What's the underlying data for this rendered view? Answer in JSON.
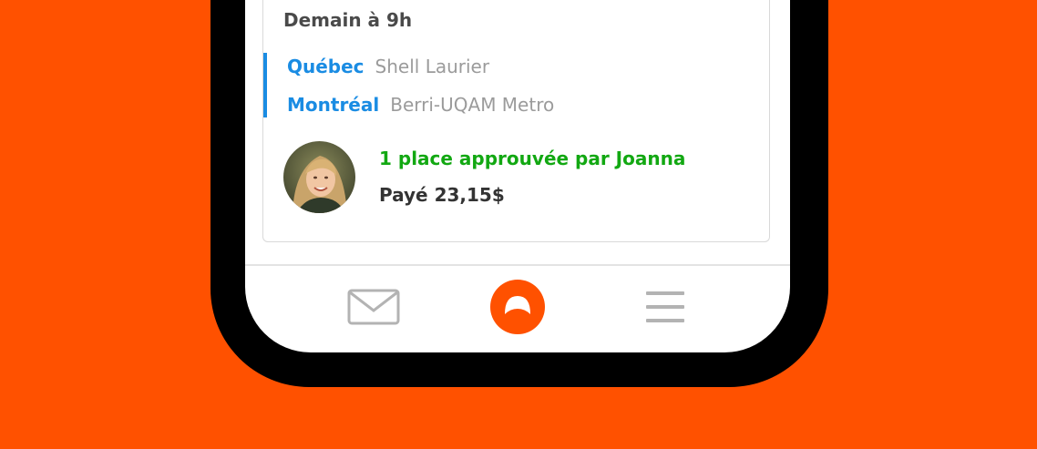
{
  "trip": {
    "when": "Demain à 9h",
    "stops": [
      {
        "city": "Québec",
        "place": "Shell Laurier"
      },
      {
        "city": "Montréal",
        "place": "Berri-UQAM Metro"
      }
    ],
    "approved": "1 place approuvée par Joanna",
    "paid": "Payé 23,15$"
  },
  "nav": {
    "items": [
      {
        "icon": "mail-icon"
      },
      {
        "icon": "home-logo-icon"
      },
      {
        "icon": "menu-icon"
      }
    ]
  },
  "colors": {
    "background": "#ff5100",
    "city": "#1a8ce3",
    "approved": "#12a812",
    "logo": "#ff5100"
  }
}
